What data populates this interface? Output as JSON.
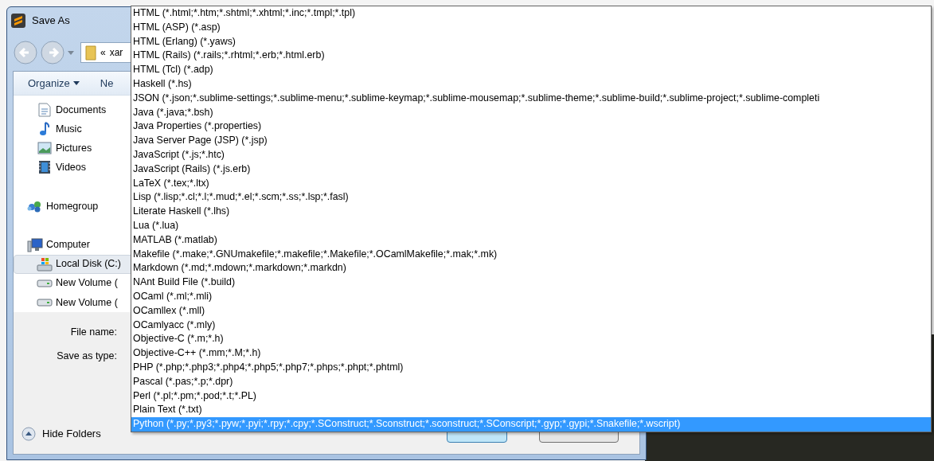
{
  "window": {
    "title": "Save As"
  },
  "address_bar": {
    "chevron": "«",
    "path": "xar"
  },
  "toolbar": {
    "organize": "Organize",
    "new_folder": "Ne"
  },
  "library_items": [
    {
      "label": "Documents",
      "kind": "document",
      "selected": false
    },
    {
      "label": "Music",
      "kind": "music",
      "selected": false
    },
    {
      "label": "Pictures",
      "kind": "pictures",
      "selected": false
    },
    {
      "label": "Videos",
      "kind": "videos",
      "selected": false
    }
  ],
  "nav_tree": [
    {
      "label": "Homegroup",
      "kind": "homegroup",
      "selected": false
    },
    {
      "label": "Computer",
      "kind": "computer",
      "selected": false,
      "children": [
        {
          "label": "Local Disk (C:)",
          "kind": "system",
          "selected": true
        },
        {
          "label": "New Volume (",
          "kind": "drive",
          "selected": false
        },
        {
          "label": "New Volume (",
          "kind": "drive",
          "selected": false
        }
      ]
    }
  ],
  "fields": [
    {
      "label": "File name:"
    },
    {
      "label": "Save as type:"
    }
  ],
  "hide_folders": "Hide Folders",
  "type_list": [
    {
      "label": "HTML (*.html;*.htm;*.shtml;*.xhtml;*.inc;*.tmpl;*.tpl)",
      "selected": false
    },
    {
      "label": "HTML (ASP) (*.asp)",
      "selected": false
    },
    {
      "label": "HTML (Erlang) (*.yaws)",
      "selected": false
    },
    {
      "label": "HTML (Rails) (*.rails;*.rhtml;*.erb;*.html.erb)",
      "selected": false
    },
    {
      "label": "HTML (Tcl) (*.adp)",
      "selected": false
    },
    {
      "label": "Haskell (*.hs)",
      "selected": false
    },
    {
      "label": "JSON (*.json;*.sublime-settings;*.sublime-menu;*.sublime-keymap;*.sublime-mousemap;*.sublime-theme;*.sublime-build;*.sublime-project;*.sublime-completi",
      "selected": false
    },
    {
      "label": "Java (*.java;*.bsh)",
      "selected": false
    },
    {
      "label": "Java Properties (*.properties)",
      "selected": false
    },
    {
      "label": "Java Server Page (JSP) (*.jsp)",
      "selected": false
    },
    {
      "label": "JavaScript (*.js;*.htc)",
      "selected": false
    },
    {
      "label": "JavaScript (Rails) (*.js.erb)",
      "selected": false
    },
    {
      "label": "LaTeX (*.tex;*.ltx)",
      "selected": false
    },
    {
      "label": "Lisp (*.lisp;*.cl;*.l;*.mud;*.el;*.scm;*.ss;*.lsp;*.fasl)",
      "selected": false
    },
    {
      "label": "Literate Haskell (*.lhs)",
      "selected": false
    },
    {
      "label": "Lua (*.lua)",
      "selected": false
    },
    {
      "label": "MATLAB (*.matlab)",
      "selected": false
    },
    {
      "label": "Makefile (*.make;*.GNUmakefile;*.makefile;*.Makefile;*.OCamlMakefile;*.mak;*.mk)",
      "selected": false
    },
    {
      "label": "Markdown (*.md;*.mdown;*.markdown;*.markdn)",
      "selected": false
    },
    {
      "label": "NAnt Build File (*.build)",
      "selected": false
    },
    {
      "label": "OCaml (*.ml;*.mli)",
      "selected": false
    },
    {
      "label": "OCamllex (*.mll)",
      "selected": false
    },
    {
      "label": "OCamlyacc (*.mly)",
      "selected": false
    },
    {
      "label": "Objective-C (*.m;*.h)",
      "selected": false
    },
    {
      "label": "Objective-C++ (*.mm;*.M;*.h)",
      "selected": false
    },
    {
      "label": "PHP (*.php;*.php3;*.php4;*.php5;*.php7;*.phps;*.phpt;*.phtml)",
      "selected": false
    },
    {
      "label": "Pascal (*.pas;*.p;*.dpr)",
      "selected": false
    },
    {
      "label": "Perl (*.pl;*.pm;*.pod;*.t;*.PL)",
      "selected": false
    },
    {
      "label": "Plain Text (*.txt)",
      "selected": false
    },
    {
      "label": "Python (*.py;*.py3;*.pyw;*.pyi;*.rpy;*.cpy;*.SConstruct;*.Sconstruct;*.sconstruct;*.SConscript;*.gyp;*.gypi;*.Snakefile;*.wscript)",
      "selected": true
    }
  ]
}
